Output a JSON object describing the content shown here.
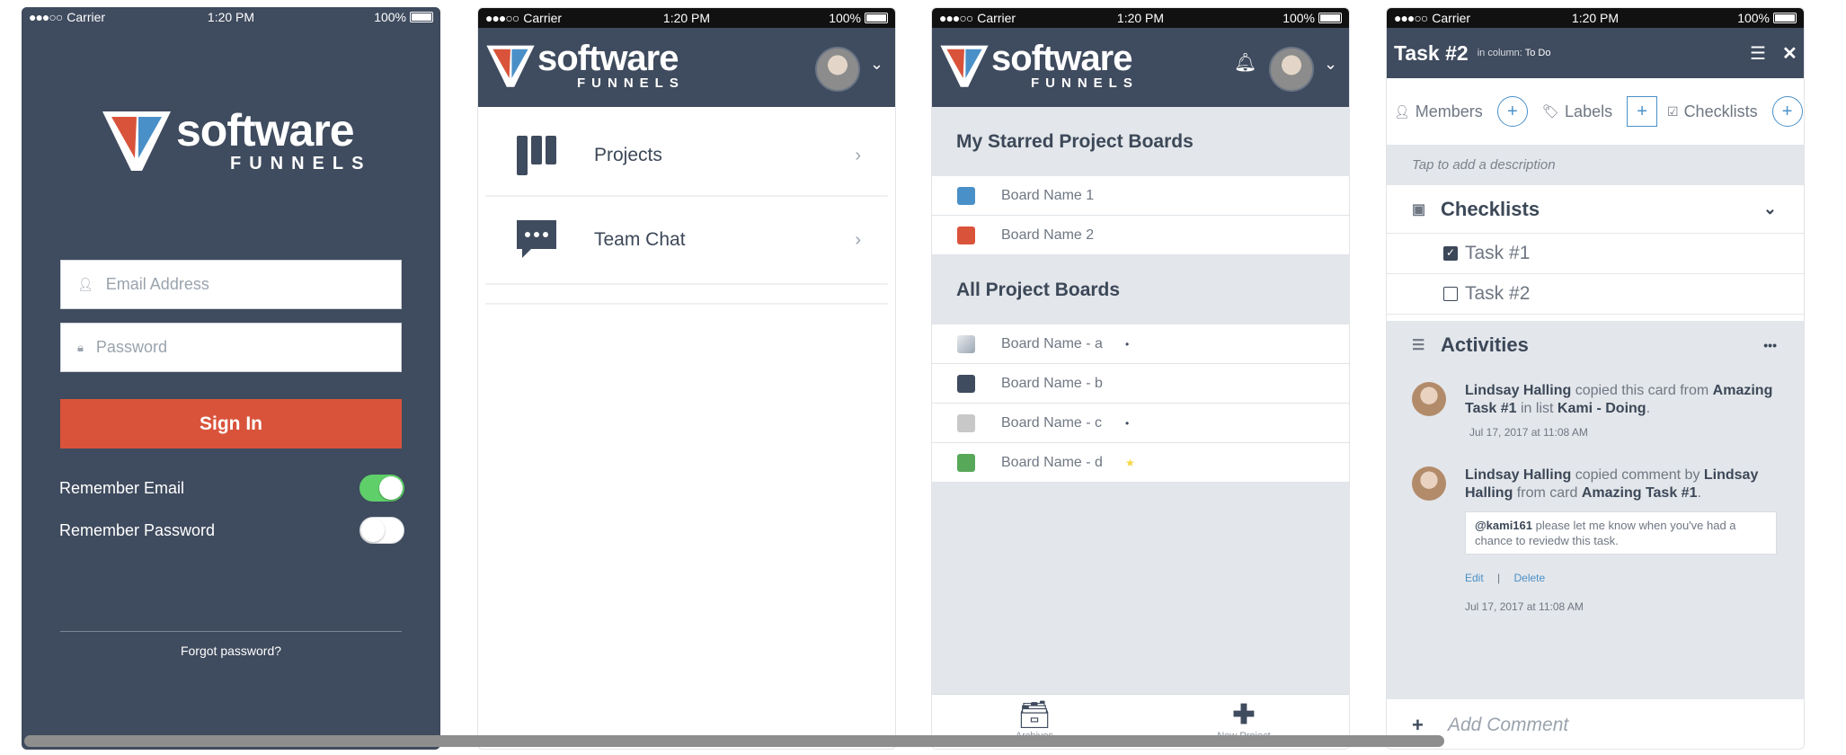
{
  "status": {
    "carrier": "Carrier",
    "time": "1:20 PM",
    "battery": "100%"
  },
  "brand": {
    "line1": "software",
    "line2": "FUNNELS"
  },
  "login": {
    "email_placeholder": "Email Address",
    "password_placeholder": "Password",
    "sign_in": "Sign In",
    "remember_email": "Remember Email",
    "remember_email_on": true,
    "remember_password": "Remember Password",
    "remember_password_on": false,
    "forgot": "Forgot password?"
  },
  "menu": {
    "items": [
      {
        "label": "Projects",
        "icon": "kanban-icon"
      },
      {
        "label": "Team Chat",
        "icon": "chat-bubble-icon"
      }
    ]
  },
  "boards": {
    "starred_title": "My Starred Project Boards",
    "starred": [
      {
        "name": "Board Name 1",
        "color": "#4a90c8"
      },
      {
        "name": "Board Name 2",
        "color": "#d9533b"
      }
    ],
    "all_title": "All Project Boards",
    "all": [
      {
        "name": "Board Name - a",
        "color": "#9ba6b3",
        "mark": "•"
      },
      {
        "name": "Board Name - b",
        "color": "#3f4b5e",
        "mark": ""
      },
      {
        "name": "Board Name - c",
        "color": "#c8c8c8",
        "mark": "•"
      },
      {
        "name": "Board Name - d",
        "color": "#58a85a",
        "mark": "★"
      }
    ],
    "tab_archives": "Archives",
    "tab_new_project": "New Project"
  },
  "task": {
    "title": "Task #2",
    "column_prefix": "in column:",
    "column": "To Do",
    "members": "Members",
    "labels": "Labels",
    "checklists_tab": "Checklists",
    "description_placeholder": "Tap to add a description",
    "checklists_title": "Checklists",
    "checklist": [
      {
        "label": "Task #1",
        "checked": true
      },
      {
        "label": "Task #2",
        "checked": false
      }
    ],
    "activities_title": "Activities",
    "activity1": {
      "user": "Lindsay Halling",
      "verb": "copied this card from",
      "card": "Amazing Task #1",
      "mid": "in list",
      "list": "Kami - Doing",
      "end": ".",
      "date": "Jul 17, 2017 at 11:08 AM"
    },
    "activity2": {
      "user": "Lindsay Halling",
      "verb": "copied comment by",
      "user2": "Lindsay Halling",
      "mid": "from card",
      "card": "Amazing Task #1",
      "end": ".",
      "mention": "@kami161",
      "comment": "please let me know when you've had a chance to reviedw this task.",
      "edit": "Edit",
      "sep": "|",
      "delete": "Delete",
      "date": "Jul 17, 2017 at 11:08 AM"
    },
    "add_comment": "Add Comment"
  }
}
